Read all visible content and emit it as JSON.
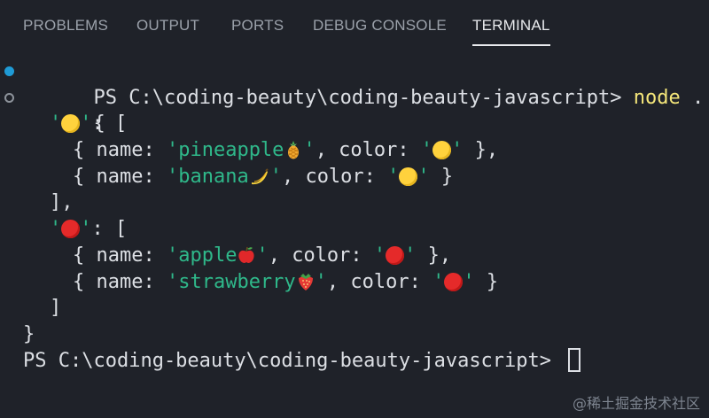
{
  "tabs": [
    {
      "label": "PROBLEMS",
      "active": false
    },
    {
      "label": "OUTPUT",
      "active": false
    },
    {
      "label": "PORTS",
      "active": false
    },
    {
      "label": "DEBUG CONSOLE",
      "active": false
    },
    {
      "label": "TERMINAL",
      "active": true
    }
  ],
  "terminal": {
    "prompt": "PS C:\\coding-beauty\\coding-beauty-javascript> ",
    "command": "node",
    "command_arg": " .",
    "open_brace": "{",
    "close_brace": "}",
    "groups": [
      {
        "key_open": "'",
        "key_close": "': [",
        "key_icon": "yellow-circle",
        "items": [
          {
            "name": "pineapple",
            "fruit_icon": "pineapple-icon",
            "color_icon": "yellow-circle"
          },
          {
            "name": "banana",
            "fruit_icon": "banana-icon",
            "color_icon": "yellow-circle"
          }
        ],
        "close": "],"
      },
      {
        "key_open": "'",
        "key_close": "': [",
        "key_icon": "red-circle",
        "items": [
          {
            "name": "apple",
            "fruit_icon": "apple-icon",
            "color_icon": "red-circle"
          },
          {
            "name": "strawberry",
            "fruit_icon": "strawberry-icon",
            "color_icon": "red-circle"
          }
        ],
        "close": "]"
      }
    ],
    "name_key": "{ name: ",
    "color_key": ", color: ",
    "quote": "'",
    "item_end_comma": " },",
    "item_end": " }"
  },
  "watermark": "@稀土掘金技术社区",
  "colors": {
    "background": "#1f2229",
    "string": "#2fb88a",
    "command": "#f4e67a",
    "success_marker": "#1f9bd6"
  }
}
